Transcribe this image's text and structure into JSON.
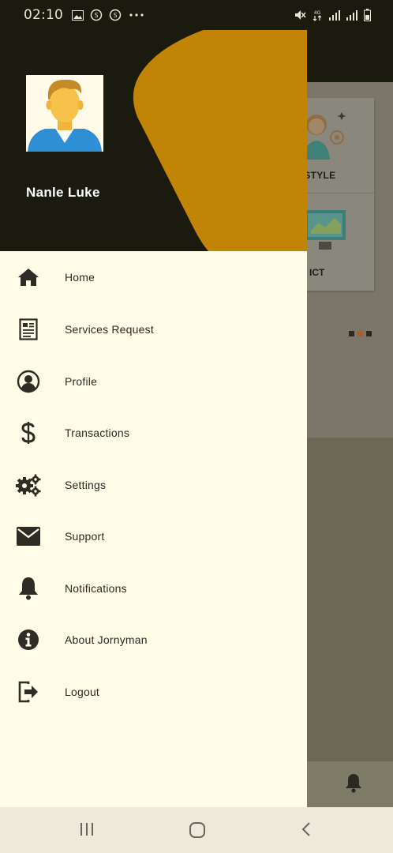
{
  "status_bar": {
    "time": "02:10",
    "left_icons": [
      "image-icon",
      "data-saver-icon",
      "data-saver-icon-2",
      "more-dots-icon"
    ],
    "right_icons": [
      "mute-icon",
      "4g-icon",
      "signal-icon",
      "signal-icon-2",
      "battery-icon"
    ]
  },
  "drawer": {
    "user_name": "Nanle Luke",
    "menu": [
      {
        "label": "Home",
        "icon": "home-icon"
      },
      {
        "label": "Services Request",
        "icon": "document-icon"
      },
      {
        "label": "Profile",
        "icon": "profile-icon"
      },
      {
        "label": "Transactions",
        "icon": "dollar-icon"
      },
      {
        "label": "Settings",
        "icon": "gears-icon"
      },
      {
        "label": "Support",
        "icon": "envelope-icon"
      },
      {
        "label": "Notifications",
        "icon": "bell-icon"
      },
      {
        "label": "About Jornyman",
        "icon": "info-icon"
      },
      {
        "label": "Logout",
        "icon": "logout-icon"
      }
    ]
  },
  "background": {
    "card_label_1": "ESTYLE",
    "card_label_2": "ICT",
    "dot_colors": [
      "#2b2a22",
      "#b85a1e",
      "#2b2a22",
      "#2b2a22"
    ]
  },
  "colors": {
    "accent": "#c28404",
    "header": "#1b1a0f",
    "drawer_bg": "#fffce8",
    "icon": "#2e2d25"
  },
  "nav_bar": {
    "buttons": [
      "recents-button",
      "home-button",
      "back-button"
    ]
  }
}
